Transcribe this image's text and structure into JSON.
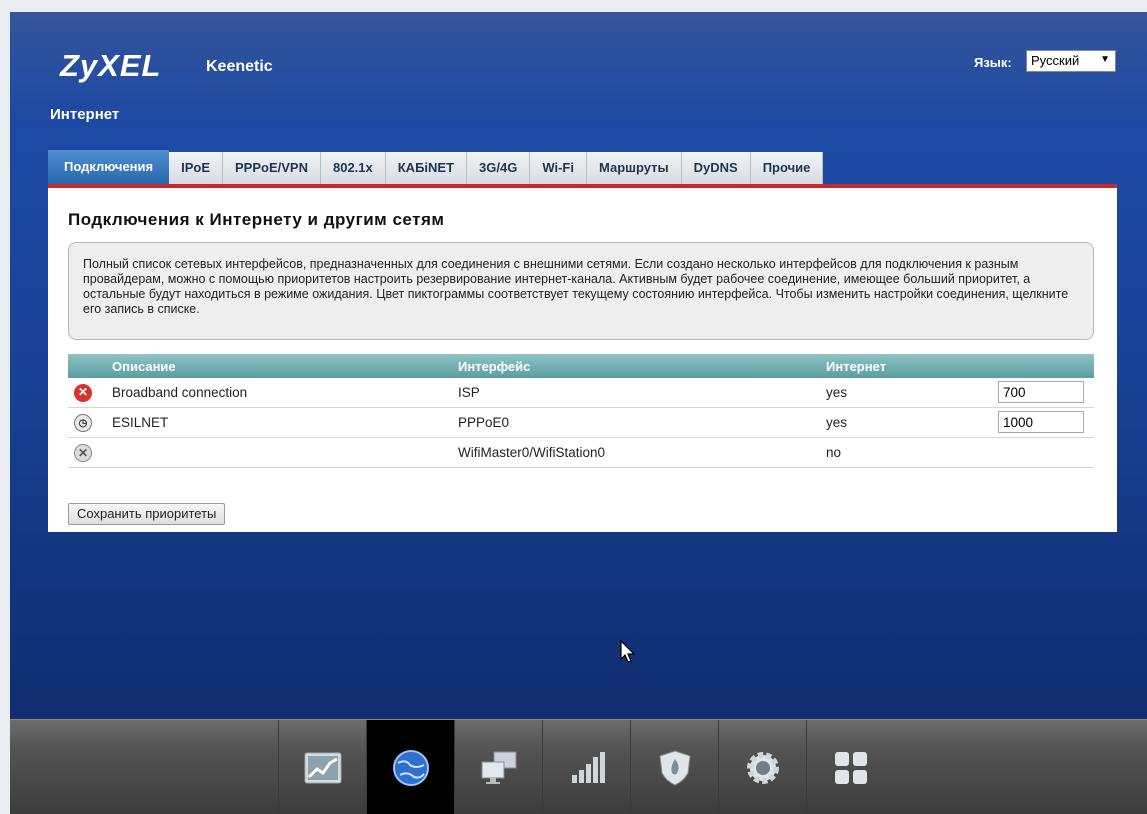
{
  "header": {
    "logo": "ZyXEL",
    "product": "Keenetic",
    "language_label": "Язык:",
    "language_value": "Русский"
  },
  "page": {
    "section_title": "Интернет"
  },
  "tabs": [
    {
      "label": "Подключения",
      "active": true
    },
    {
      "label": "IPoE"
    },
    {
      "label": "PPPoE/VPN"
    },
    {
      "label": "802.1x"
    },
    {
      "label": "КАБiNET"
    },
    {
      "label": "3G/4G"
    },
    {
      "label": "Wi-Fi"
    },
    {
      "label": "Маршруты"
    },
    {
      "label": "DyDNS"
    },
    {
      "label": "Прочие"
    }
  ],
  "panel": {
    "title": "Подключения к Интернету и другим сетям",
    "info": "Полный список сетевых интерфейсов, предназначенных для соединения с внешними сетями. Если создано несколько интерфейсов для подключения к разным провайдерам, можно с помощью приоритетов настроить резервирование интернет-канала. Активным будет рабочее соединение, имеющее больший приоритет, а остальные будут находиться в режиме ожидания. Цвет пиктограммы соответствует текущему состоянию интерфейса. Чтобы изменить настройки соединения, щелкните его запись в списке."
  },
  "table": {
    "headers": {
      "description": "Описание",
      "interface": "Интерфейс",
      "internet": "Интернет"
    },
    "rows": [
      {
        "status": "error-icon",
        "description": "Broadband connection",
        "interface": "ISP",
        "internet": "yes",
        "priority": "700"
      },
      {
        "status": "waiting-icon",
        "description": "ESILNET",
        "interface": "PPPoE0",
        "internet": "yes",
        "priority": "1000"
      },
      {
        "status": "disabled-icon",
        "description": "",
        "interface": "WifiMaster0/WifiStation0",
        "internet": "no",
        "priority": ""
      }
    ]
  },
  "buttons": {
    "save_priorities": "Сохранить приоритеты"
  },
  "bottom_nav": [
    {
      "icon": "monitor-chart-icon"
    },
    {
      "icon": "globe-icon",
      "active": true
    },
    {
      "icon": "home-network-icon"
    },
    {
      "icon": "wifi-signal-icon"
    },
    {
      "icon": "security-shield-icon"
    },
    {
      "icon": "gear-icon"
    },
    {
      "icon": "apps-grid-icon"
    }
  ]
}
